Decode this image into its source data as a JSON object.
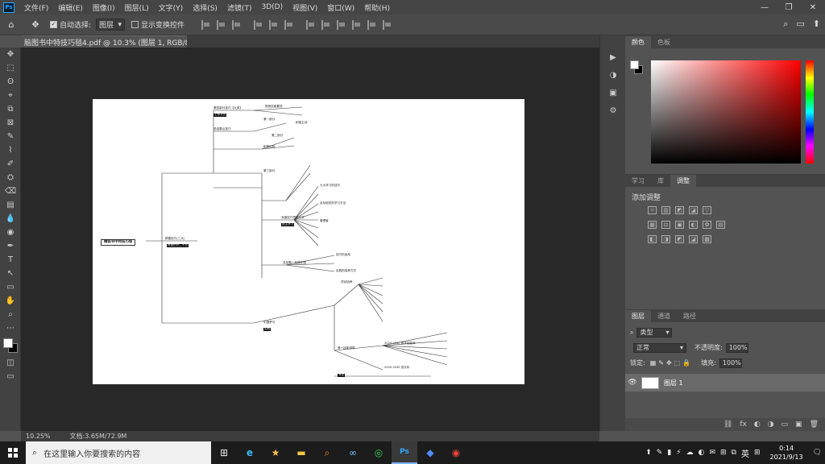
{
  "menubar": {
    "logo": "Ps",
    "items": [
      "文件(F)",
      "编辑(E)",
      "图像(I)",
      "图层(L)",
      "文字(Y)",
      "选择(S)",
      "滤镜(T)",
      "3D(D)",
      "视图(V)",
      "窗口(W)",
      "帮助(H)"
    ],
    "win_min": "—",
    "win_max": "❐",
    "win_close": "✕"
  },
  "options": {
    "home": "⌂",
    "move": "✥",
    "auto_select_label": "自动选择:",
    "auto_select_value": "图层",
    "show_transform_label": "显示变换控件",
    "right_icons": [
      "⌕",
      "▭",
      "⬆"
    ]
  },
  "document": {
    "tab_title": "脑图书中特技巧毯4.pdf @ 10.3% (图层 1, RGB/8)",
    "tab_close": "✕",
    "zoom": "10.25%",
    "doc_size": "文档:3.65M/72.9M"
  },
  "mindmap": {
    "root": "精装书中特技巧毯",
    "root_tag": "阿里巴巴二十五",
    "branch1": "精要技巧(三大)",
    "nodes": [
      "第四部分技巧【大类】",
      "总结要点技巧",
      "熟悉技能要项",
      "第一部分",
      "积极主动",
      "积极自我",
      "第二部分",
      "第三部分",
      "深度技巧思维方式",
      "总结第一技能处理",
      "七大学习的技巧",
      "目标相关的学习方法",
      "管理者",
      "技巧的运用",
      "实践的培养方式",
      "中国罗马",
      "项目培养",
      "第一技能领导",
      "2020-2030 基本技能年",
      "2020-2030 成长年"
    ],
    "tags": [
      "工作方式",
      "自主学习",
      "实践",
      "专业"
    ]
  },
  "color_panel": {
    "tabs": [
      "颜色",
      "色板"
    ],
    "fg": "#ffffff",
    "bg": "#000000",
    "hue": "#ff0000"
  },
  "adjust_panel": {
    "tabs": [
      "学习",
      "库",
      "调整"
    ],
    "title": "添加调整",
    "row1": [
      "☼",
      "▥",
      "◩",
      "◪",
      "▽"
    ],
    "row2": [
      "▦",
      "⚖",
      "▣",
      "◐",
      "✿",
      "▤"
    ],
    "row3": [
      "◧",
      "◨",
      "◩",
      "◪",
      "▩"
    ]
  },
  "layers_panel": {
    "tabs": [
      "图层",
      "通道",
      "路径"
    ],
    "filter_label": "类型",
    "mode": "正常",
    "opacity_label": "不透明度:",
    "opacity": "100%",
    "lock_label": "锁定:",
    "fill_label": "填充:",
    "fill": "100%",
    "layer_name": "图层 1",
    "eye": "👁",
    "bottom_icons": [
      "⛓",
      "fx",
      "◐",
      "◑",
      "▭",
      "▣",
      "🗑"
    ]
  },
  "toolbar": {
    "tools": [
      "✥",
      "⬚",
      "ʘ",
      "⌖",
      "⧉",
      "⊠",
      "✎",
      "⌇",
      "✐",
      "⛭",
      "⌫",
      "▤",
      "💧",
      "◉",
      "✒",
      "T",
      "↖",
      "▭",
      "✋",
      "⌕",
      "⋯"
    ],
    "fg": "#ffffff",
    "bg": "#000000"
  },
  "collapse_strip": {
    "icons": [
      "▶",
      "◑",
      "▣",
      "⚙"
    ]
  },
  "taskbar": {
    "search_placeholder": "在这里输入你要搜索的内容",
    "search_icon": "⌕",
    "apps": [
      "⊞",
      "e",
      "★",
      "▬",
      "⌕",
      "∞",
      "◎",
      "Ps",
      "◆",
      "◉"
    ],
    "tray": [
      "⬆",
      "✎",
      "▮",
      "⚡",
      "☁",
      "◐",
      "✉",
      "⊞",
      "⧉"
    ],
    "ime": "英",
    "grid": "⊞",
    "time": "0:14",
    "date": "2021/9/13",
    "notify": "🗨"
  }
}
